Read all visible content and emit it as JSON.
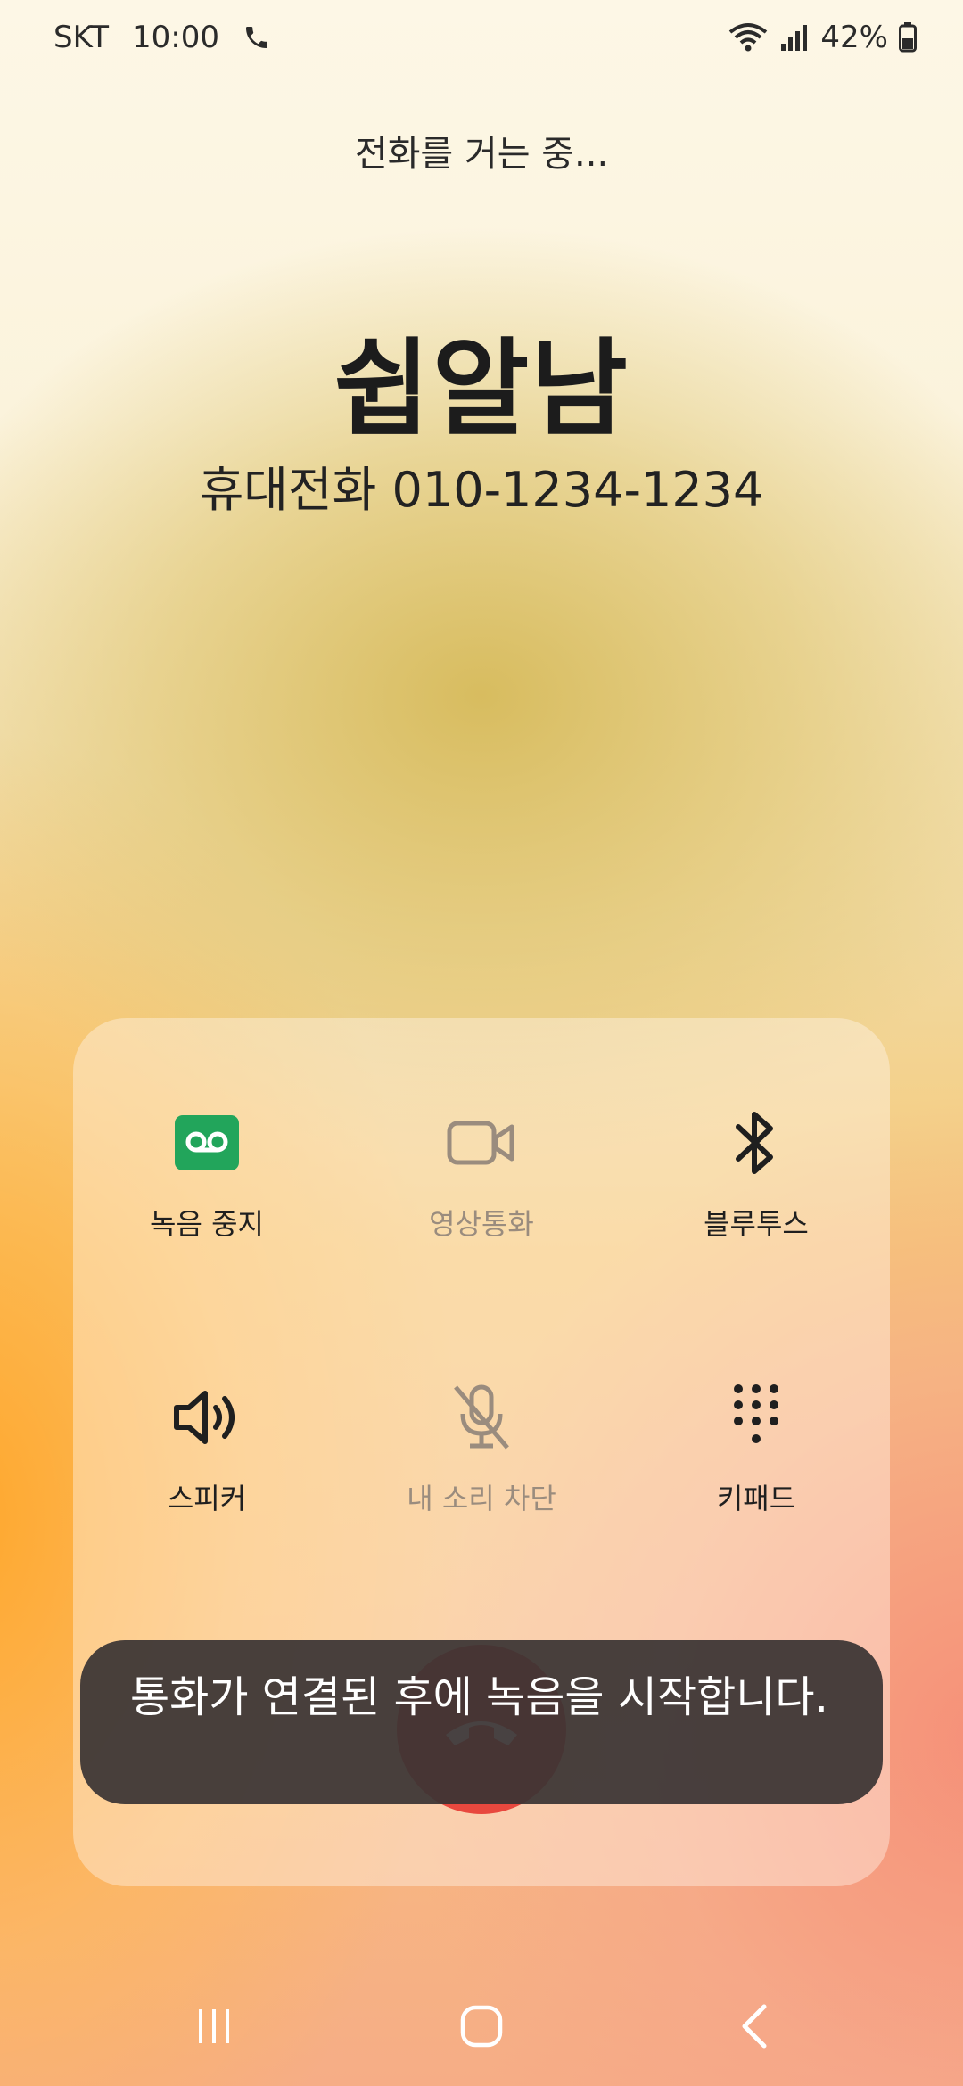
{
  "status_bar": {
    "carrier": "SKT",
    "time": "10:00",
    "call_icon": "phone-icon",
    "wifi_icon": "wifi-icon",
    "signal_icon": "signal-icon",
    "battery": "42%"
  },
  "call": {
    "status": "전화를 거는 중...",
    "contact_name": "쉽알남",
    "number_line": "휴대전화 010-1234-1234"
  },
  "controls": [
    {
      "label": "녹음 중지",
      "icon": "voicemail-record-icon",
      "enabled": true
    },
    {
      "label": "영상통화",
      "icon": "video-camera-icon",
      "enabled": false
    },
    {
      "label": "블루투스",
      "icon": "bluetooth-icon",
      "enabled": true
    },
    {
      "label": "스피커",
      "icon": "speaker-icon",
      "enabled": true
    },
    {
      "label": "내 소리 차단",
      "icon": "mic-off-icon",
      "enabled": false
    },
    {
      "label": "키패드",
      "icon": "keypad-icon",
      "enabled": true
    }
  ],
  "end_call": {
    "icon": "end-call-icon",
    "color": "#e8483e"
  },
  "toast": {
    "message": "통화가 연결된 후에 녹음을 시작합니다."
  },
  "navigation": {
    "recents": "recents-icon",
    "home": "home-icon",
    "back": "back-icon"
  },
  "colors": {
    "record_green": "#22a55b",
    "end_call_red": "#e8483e"
  }
}
